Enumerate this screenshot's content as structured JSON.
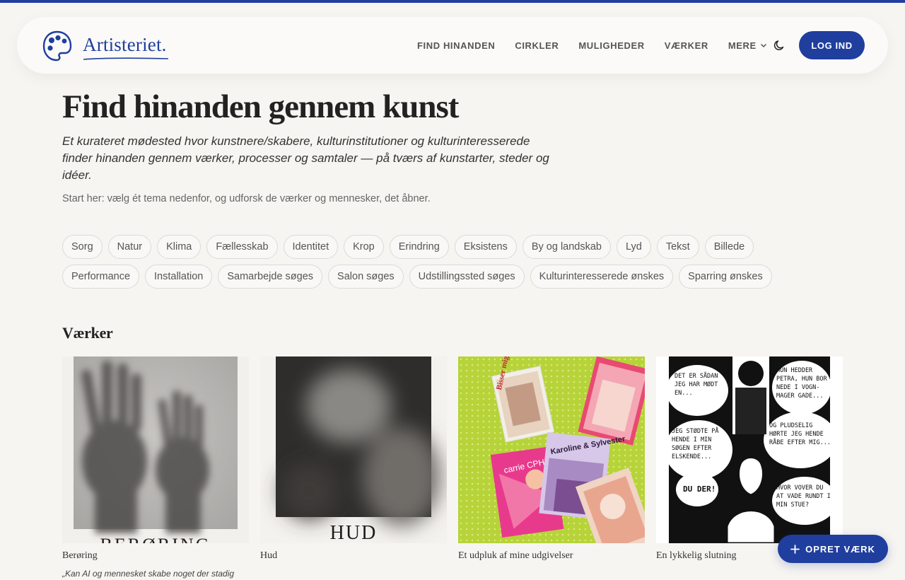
{
  "brand": {
    "name": "Artisteriet.",
    "accent": "#1f3e9e"
  },
  "nav": {
    "links": [
      "FIND HINANDEN",
      "CIRKLER",
      "MULIGHEDER",
      "VÆRKER"
    ],
    "more_label": "MERE",
    "theme_icon": "moon-icon",
    "login_label": "LOG IND"
  },
  "hero": {
    "title": "Find hinanden gennem kunst",
    "subtitle": "Et kurateret mødested hvor kunstnere/skabere, kulturinstitutioner og kulturinteresserede finder hinanden gennem værker, processer og samtaler — på tværs af kunstarter, steder og idéer.",
    "hint": "Start her: vælg ét tema nedenfor, og udforsk de værker og mennesker, det åbner."
  },
  "tags": [
    "Sorg",
    "Natur",
    "Klima",
    "Fællesskab",
    "Identitet",
    "Krop",
    "Erindring",
    "Eksistens",
    "By og landskab",
    "Lyd",
    "Tekst",
    "Billede",
    "Performance",
    "Installation",
    "Samarbejde søges",
    "Salon søges",
    "Udstillingssted søges",
    "Kulturinteresserede ønskes",
    "Sparring ønskes"
  ],
  "works": {
    "section_title": "Værker",
    "items": [
      {
        "title": "Berøring",
        "caption": "BERØRING",
        "description": "„Kan AI og mennesket skabe noget der stadig"
      },
      {
        "title": "Hud",
        "caption": "HUD",
        "description": ""
      },
      {
        "title": "Et udpluk af mine udgivelser",
        "caption": "",
        "description": "",
        "book_labels": [
          "Bisser mig ikke!",
          "Karoline & Sylvester",
          "carrie CPH"
        ]
      },
      {
        "title": "En lykkelig slutning",
        "caption": "",
        "description": "",
        "comic_lines": [
          "DET ER SÅDAN JEG HAR MØDT EN...",
          "HUN HEDDER PETRA, HUN BOR NEDE I VOGN-MAGER GADE...",
          "JEG STØDTE PÅ HENDE I MIN SØGEN EFTER ELSKENDE...",
          "OG PLUDSELIG HØRTE JEG HENDE RÅBE EFTER MIG...",
          "DU DER!",
          "HVOR VOVER DU AT VADE RUNDT I MIN STUE?"
        ]
      }
    ]
  },
  "create_button": {
    "label": "OPRET VÆRK",
    "icon": "plus-icon"
  }
}
